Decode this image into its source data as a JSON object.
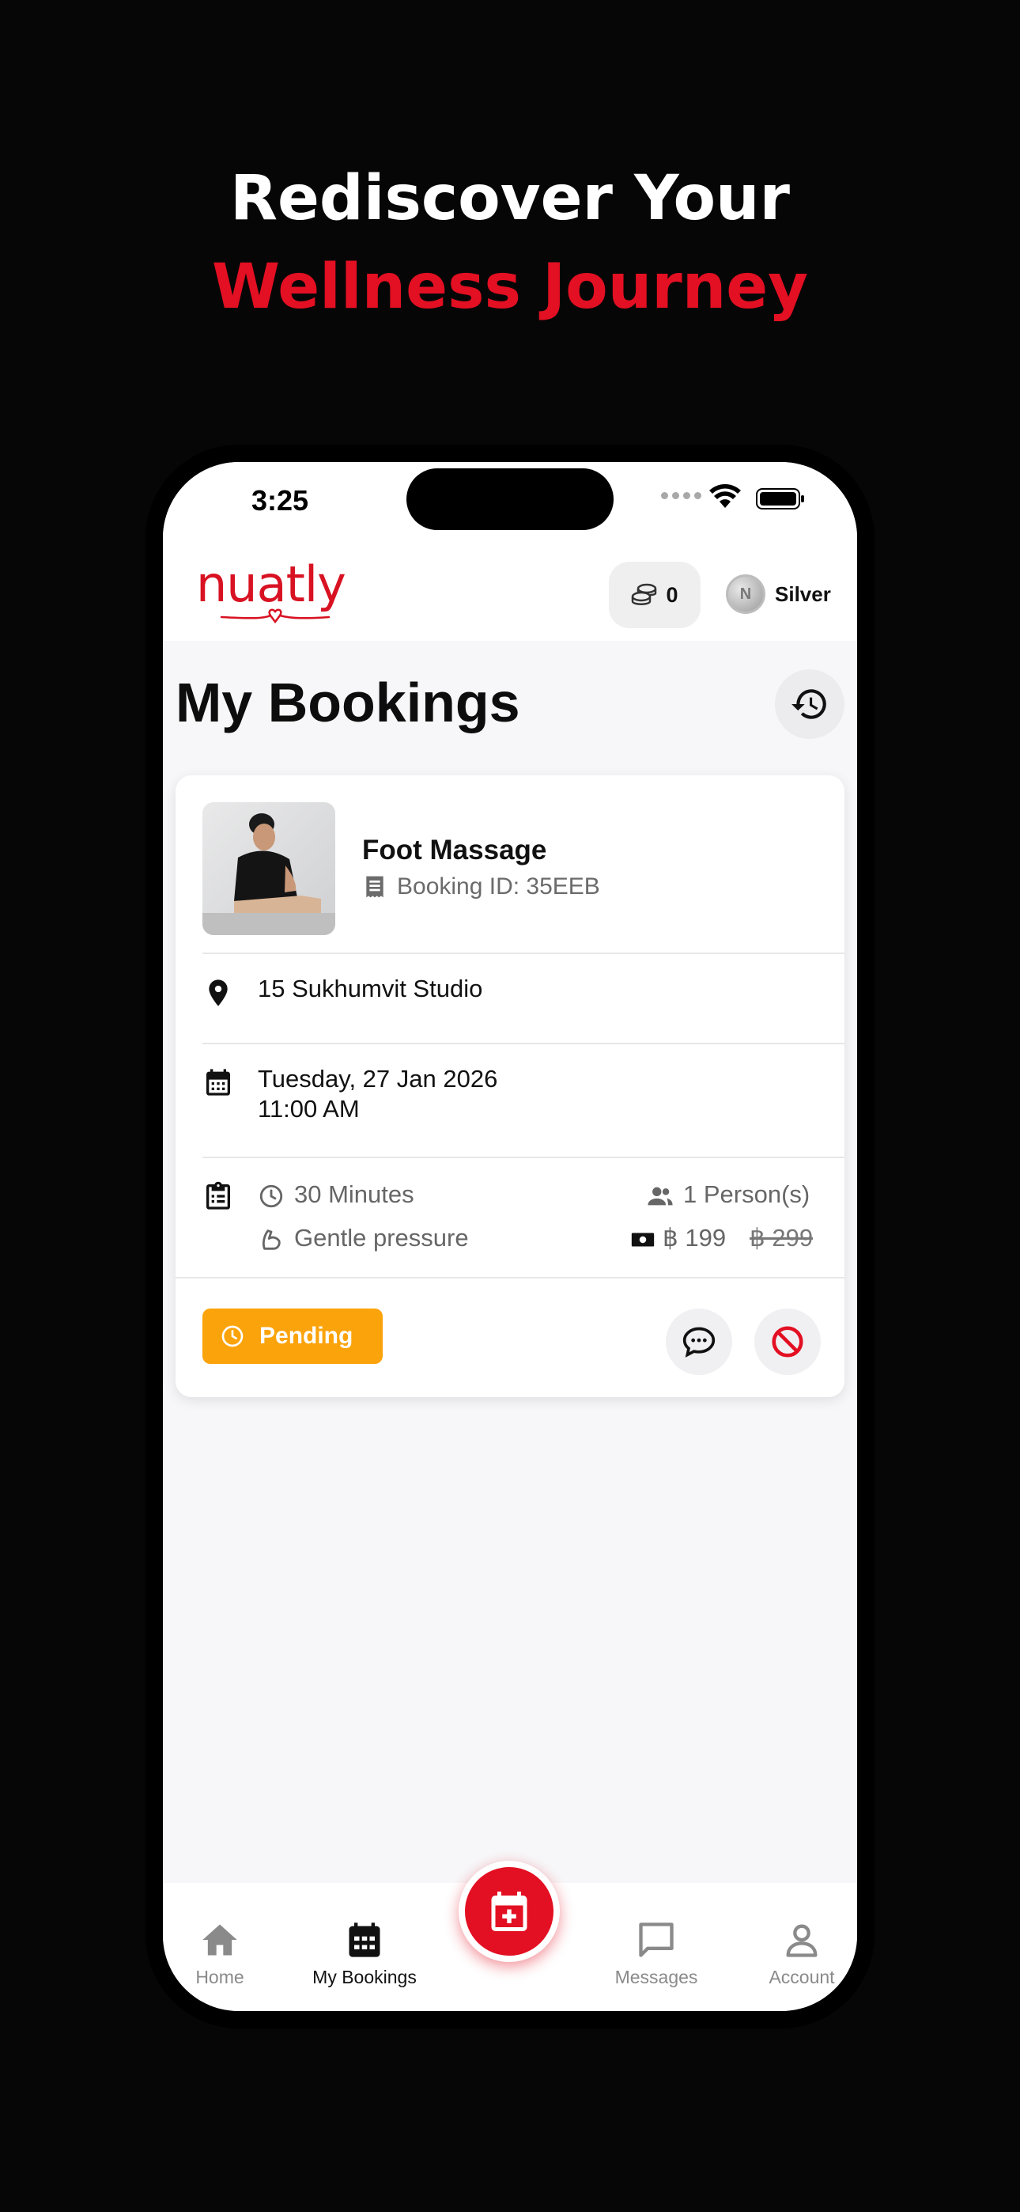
{
  "headline": {
    "line1": "Rediscover Your",
    "line2": "Wellness Journey"
  },
  "status_bar": {
    "time": "3:25"
  },
  "header": {
    "logo_text": "nuatly",
    "coins": "0",
    "tier": "Silver",
    "tier_badge_letter": "N"
  },
  "page": {
    "title": "My Bookings"
  },
  "booking": {
    "service": "Foot Massage",
    "booking_id": "Booking ID: 35EEB",
    "location": "15 Sukhumvit Studio",
    "date": "Tuesday, 27 Jan 2026",
    "time": "11:00 AM",
    "duration": "30 Minutes",
    "pressure": "Gentle pressure",
    "persons": "1 Person(s)",
    "price": "฿ 199",
    "original_price": "฿ 299",
    "status": "Pending"
  },
  "tabs": [
    {
      "label": "Home"
    },
    {
      "label": "My Bookings"
    },
    {
      "label": "Messages"
    },
    {
      "label": "Account"
    }
  ],
  "colors": {
    "brand_red": "#e30f22",
    "pending_orange": "#fba30a",
    "background": "#070607"
  }
}
